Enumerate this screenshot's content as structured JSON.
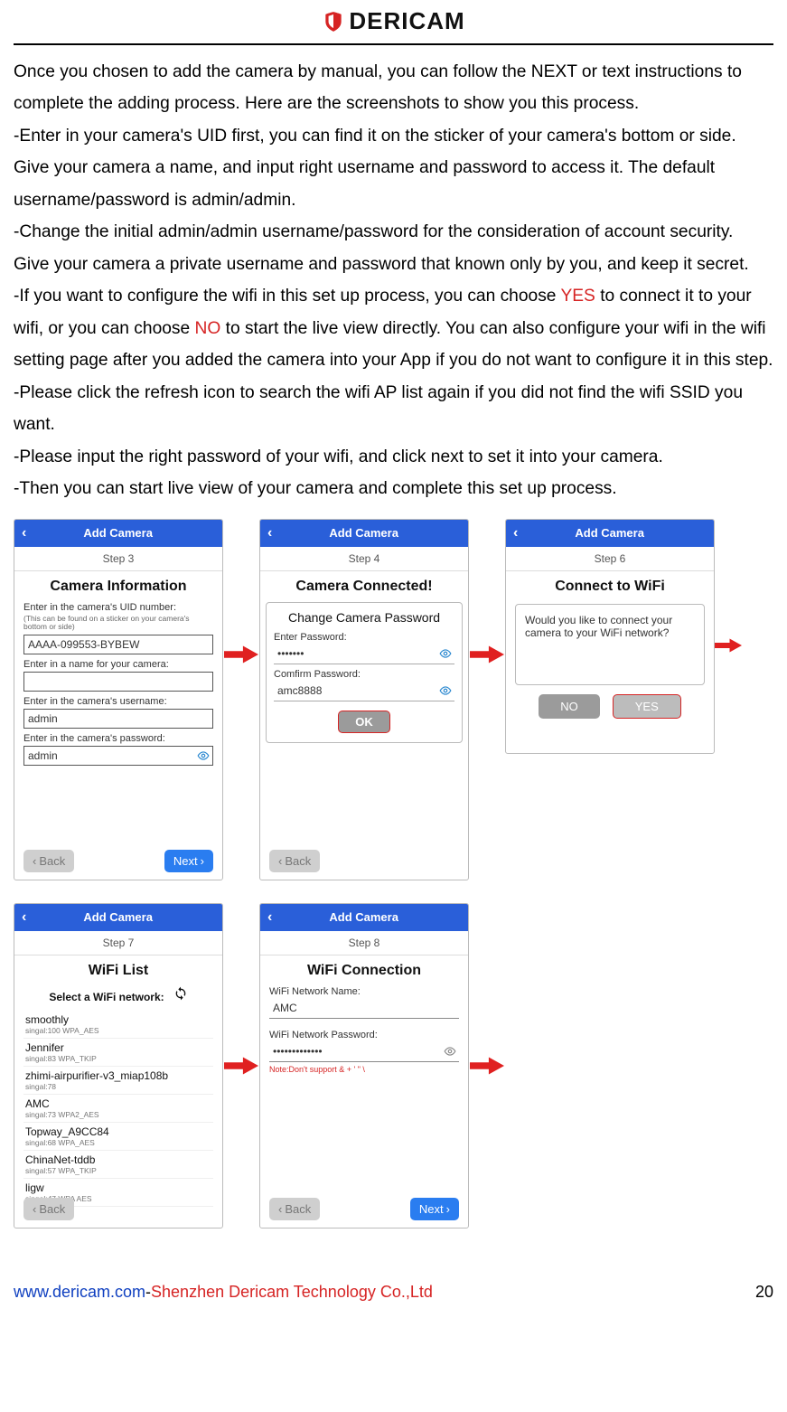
{
  "brand_name": "DERICAM",
  "instructions": {
    "p1": "Once you chosen to add the camera by manual, you can follow the NEXT or text instructions to complete the adding process. Here are the screenshots to show you this process.",
    "p2": "-Enter in your camera's UID first, you can find it on the sticker of your camera's bottom or side. Give your camera a name, and input right username and password to access it. The default username/password is admin/admin.",
    "p3": "-Change the initial admin/admin username/password for the consideration of account security. Give your camera a private username and password that known only by you, and keep it secret.",
    "p4a": "-If you want to configure the wifi in this set up process, you can choose ",
    "p4_yes": "YES",
    "p4b": " to connect it to your wifi, or you can choose ",
    "p4_no": "NO",
    "p4c": " to start the live view directly. You can also configure your wifi in the wifi setting page after you added the camera into your App if you do not want to configure it in this step.",
    "p5": "-Please click the refresh icon to search the wifi AP list again if you did not find the wifi SSID you want.",
    "p6": "-Please input the right password of your wifi, and click next to set it into your camera.",
    "p7": "-Then you can start live view of your camera and complete this set up process."
  },
  "common": {
    "add_camera": "Add Camera",
    "back": "Back",
    "next": "Next"
  },
  "screen3": {
    "step": "Step 3",
    "title": "Camera Information",
    "uid_lbl": "Enter in the camera's UID number:",
    "uid_tiny": "(This can be found on a sticker on your camera's bottom or side)",
    "uid_val": "AAAA-099553-BYBEW",
    "name_lbl": "Enter in a name for your camera:",
    "name_val": "",
    "user_lbl": "Enter in the camera's username:",
    "user_val": "admin",
    "pass_lbl": "Enter in the camera's password:",
    "pass_val": "admin"
  },
  "screen4": {
    "step": "Step 4",
    "title": "Camera Connected!",
    "modal_title": "Change Camera Password",
    "pw_lbl": "Enter Password:",
    "pw_val": "•••••••",
    "cpw_lbl": "Comfirm Password:",
    "cpw_val": "amc8888",
    "ok": "OK"
  },
  "screen6": {
    "step": "Step 6",
    "title": "Connect to WiFi",
    "prompt": "Would you like to connect your camera to your WiFi network?",
    "no": "NO",
    "yes": "YES"
  },
  "screen7": {
    "step": "Step 7",
    "title": "WiFi List",
    "select_lbl": "Select a WiFi network:",
    "list": [
      {
        "ssid": "smoothly",
        "meta": "singal:100   WPA_AES"
      },
      {
        "ssid": "Jennifer",
        "meta": "singal:83   WPA_TKIP"
      },
      {
        "ssid": "zhimi-airpurifier-v3_miap108b",
        "meta": "singal:78"
      },
      {
        "ssid": "AMC",
        "meta": "singal:73   WPA2_AES"
      },
      {
        "ssid": "Topway_A9CC84",
        "meta": "singal:68   WPA_AES"
      },
      {
        "ssid": "ChinaNet-tddb",
        "meta": "singal:57   WPA_TKIP"
      },
      {
        "ssid": "ligw",
        "meta": "singal:47   WPA  AES"
      }
    ]
  },
  "screen8": {
    "step": "Step 8",
    "title": "WiFi Connection",
    "name_lbl": "WiFi Network Name:",
    "name_val": "AMC",
    "pw_lbl": "WiFi Network Password:",
    "pw_val": "•••••••••••••",
    "note": "Note:Don't support & + ' \" \\"
  },
  "footer": {
    "site": "www.dericam.com",
    "dash": "-",
    "company": "Shenzhen Dericam Technology Co.,Ltd",
    "page": "20"
  }
}
